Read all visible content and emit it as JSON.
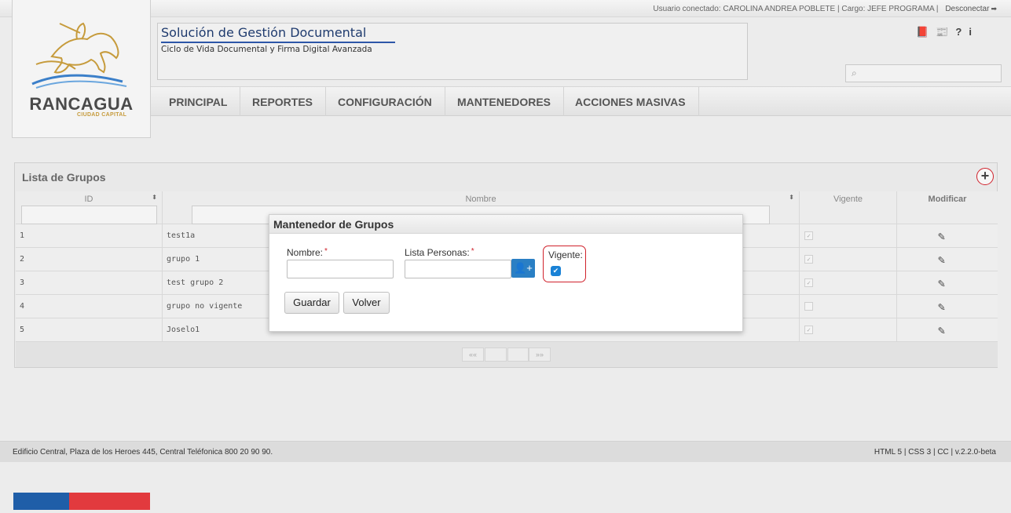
{
  "topbar": {
    "user_info": "Usuario conectado: CAROLINA ANDREA POBLETE | Cargo: JEFE PROGRAMA |",
    "logout": "Desconectar"
  },
  "logo": {
    "name": "RANCAGUA",
    "sub": "CIUDAD CAPITAL"
  },
  "header": {
    "title": "Solución de Gestión Documental",
    "subtitle": "Ciclo de Vida Documental y Firma Digital Avanzada"
  },
  "tools": {
    "help": "?",
    "info": "i"
  },
  "search": {
    "placeholder": ""
  },
  "nav": [
    "PRINCIPAL",
    "REPORTES",
    "CONFIGURACIÓN",
    "MANTENEDORES",
    "ACCIONES MASIVAS"
  ],
  "panel": {
    "title": "Lista de Grupos",
    "add_symbol": "+"
  },
  "table": {
    "headers": {
      "id": "ID",
      "nombre": "Nombre",
      "vigente": "Vigente",
      "modificar": "Modificar"
    },
    "rows": [
      {
        "id": "1",
        "nombre": "test1a",
        "vigente": true
      },
      {
        "id": "2",
        "nombre": "grupo 1",
        "vigente": true
      },
      {
        "id": "3",
        "nombre": "test grupo 2",
        "vigente": true
      },
      {
        "id": "4",
        "nombre": "grupo no vigente",
        "vigente": false
      },
      {
        "id": "5",
        "nombre": "Joselo1",
        "vigente": true
      }
    ]
  },
  "pager": {
    "first": "«",
    "last": "»"
  },
  "modal": {
    "title": "Mantenedor de Grupos",
    "nombre_label": "Nombre:",
    "personas_label": "Lista Personas:",
    "vigente_label": "Vigente:",
    "required_mark": "*",
    "vigente_checked": true,
    "save": "Guardar",
    "back": "Volver"
  },
  "footer": {
    "address": "Edificio Central, Plaza de los Heroes 445, Central Teléfonica 800 20 90 90.",
    "version": "HTML 5 | CSS 3 | CC | v.2.2.0-beta"
  },
  "colors": {
    "accent_red": "#d0212b",
    "blue": "#2a7fc4",
    "flag_blue": "#1f5ea8",
    "flag_red": "#e23a3e"
  }
}
